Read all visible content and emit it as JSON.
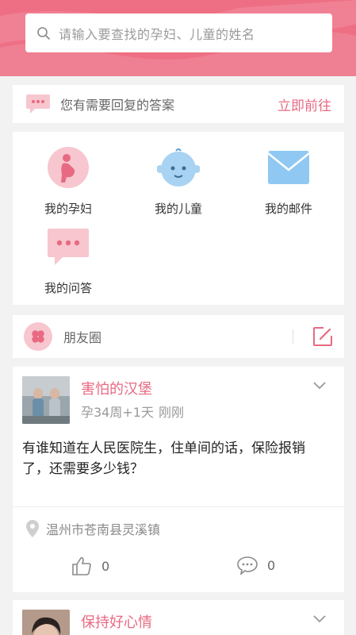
{
  "search": {
    "placeholder": "请输入要查找的孕妇、儿童的姓名",
    "icon": "search-icon"
  },
  "reply_banner": {
    "text": "您有需要回复的答案",
    "action": "立即前往",
    "icon": "chat-bubble-icon"
  },
  "menu": [
    {
      "label": "我的孕妇",
      "icon": "pregnant-woman-icon"
    },
    {
      "label": "我的儿童",
      "icon": "baby-face-icon"
    },
    {
      "label": "我的邮件",
      "icon": "mail-icon"
    },
    {
      "label": "我的问答",
      "icon": "chat-bubble-icon"
    }
  ],
  "friends": {
    "label": "朋友圈",
    "icon": "clover-icon",
    "compose_icon": "edit-icon"
  },
  "posts": [
    {
      "name": "害怕的汉堡",
      "stage": "孕34周+1天",
      "time": "刚刚",
      "content": "有谁知道在人民医院生，住单间的话，保险报销了，还需要多少钱？",
      "location": "温州市苍南县灵溪镇",
      "likes": "0",
      "comments": "0"
    },
    {
      "name": "保持好心情"
    }
  ],
  "colors": {
    "accent": "#e86a82",
    "header": "#ee6f84",
    "icon_pink": "#f7c6cf"
  }
}
